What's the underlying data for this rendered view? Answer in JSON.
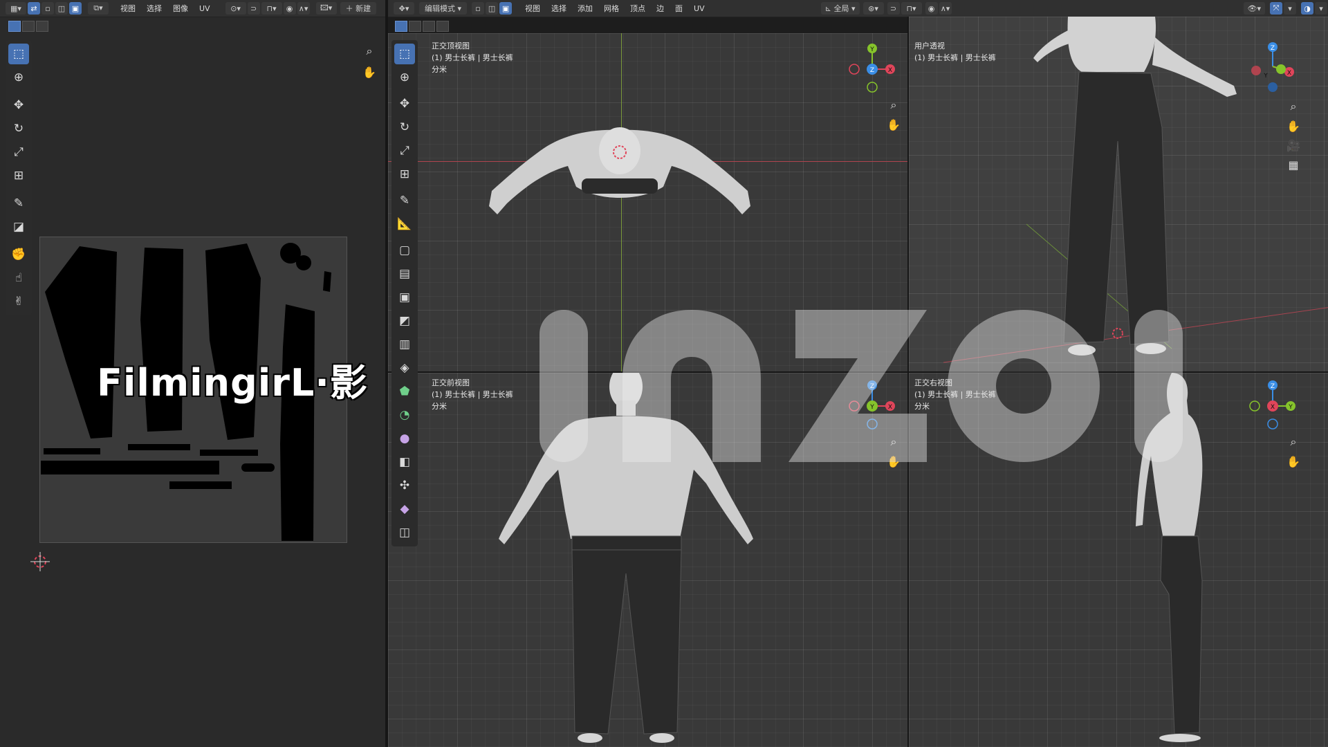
{
  "uv_editor": {
    "menu": [
      "视图",
      "选择",
      "图像",
      "UV"
    ],
    "new_button": "新建"
  },
  "viewport_header": {
    "mode": "编辑模式",
    "menu": [
      "视图",
      "选择",
      "添加",
      "网格",
      "顶点",
      "边",
      "面",
      "UV"
    ],
    "transform_orientation": "全局"
  },
  "viewports": [
    {
      "title": "正交顶视图",
      "object": "(1) 男士长裤 | 男士长裤",
      "units": "分米"
    },
    {
      "title": "用户透视",
      "object": "(1) 男士长裤 | 男士长裤",
      "units": ""
    },
    {
      "title": "正交前视图",
      "object": "(1) 男士长裤 | 男士长裤",
      "units": "分米"
    },
    {
      "title": "正交右视图",
      "object": "(1) 男士长裤 | 男士长裤",
      "units": "分米"
    }
  ],
  "gizmo_labels": {
    "top": [
      "Y",
      "Z",
      "X"
    ],
    "user": [
      "Z",
      "Y",
      "X"
    ],
    "front": [
      "Z",
      "Y",
      "X"
    ],
    "right": [
      "Z",
      "X",
      "Y"
    ]
  },
  "watermarks": {
    "brand": "inZOI",
    "signature": "FilmingirL·影"
  },
  "colors": {
    "accent": "#4772b3",
    "axis_x": "#e0455a",
    "axis_y": "#86c42b",
    "axis_z": "#3a8ee6"
  }
}
